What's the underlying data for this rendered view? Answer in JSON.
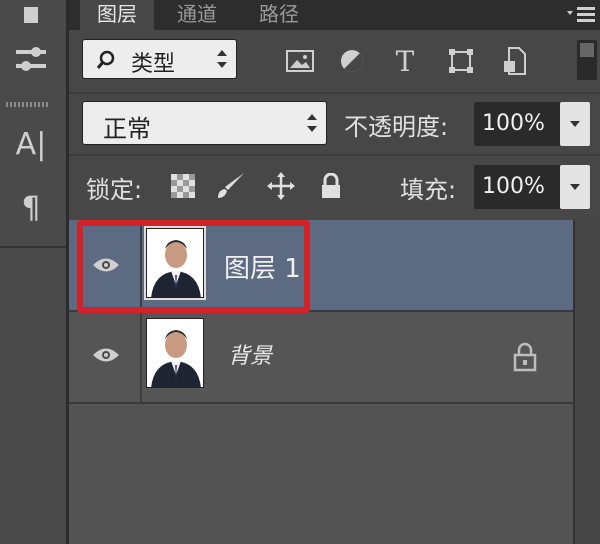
{
  "tabs": [
    {
      "label": "图层",
      "active": true
    },
    {
      "label": "通道",
      "active": false
    },
    {
      "label": "路径",
      "active": false
    }
  ],
  "panel_menu_icon": "panel-menu-icon",
  "filter": {
    "search_icon": "search-icon",
    "kind_label": "类型",
    "filter_icons": [
      "image-filter-icon",
      "adjustment-filter-icon",
      "type-filter-icon",
      "shape-filter-icon",
      "smart-object-filter-icon"
    ]
  },
  "blend": {
    "mode": "正常",
    "opacity_label": "不透明度:",
    "opacity_value": "100%"
  },
  "lock": {
    "label": "锁定:",
    "icons": [
      "lock-transparent-pixels-icon",
      "lock-image-pixels-icon",
      "lock-position-icon",
      "lock-all-icon"
    ],
    "fill_label": "填充:",
    "fill_value": "100%"
  },
  "layers": [
    {
      "name": "图层 1",
      "visible": true,
      "selected": true,
      "locked": false
    },
    {
      "name": "背景",
      "visible": true,
      "selected": false,
      "locked": true
    }
  ],
  "colors": {
    "annotation_box": "#d22127",
    "selected_row": "#5d6b82"
  },
  "toolstrip_icons": [
    "history-brush-icon",
    "adjustments-icon",
    "character-panel-icon",
    "paragraph-icon"
  ]
}
